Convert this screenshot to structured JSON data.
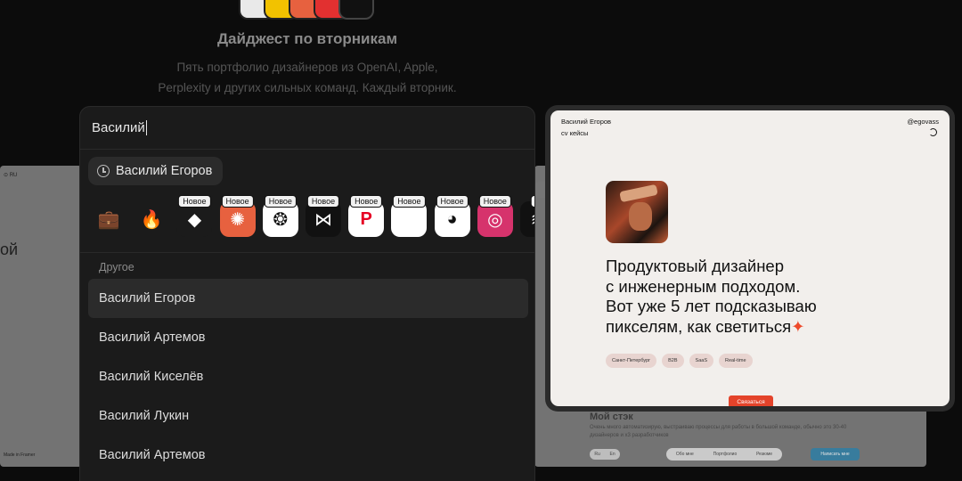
{
  "header": {
    "title": "Дайджест по вторникам",
    "subtitle_line1": "Пять портфолио дизайнеров из OpenAI, Apple,",
    "subtitle_line2": "Perplexity и других сильных команд. Каждый вторник."
  },
  "search": {
    "value": "Василий"
  },
  "recent": {
    "label": "Василий Егоров"
  },
  "app_strip": [
    {
      "name": "briefcase-icon",
      "glyph": "💼",
      "badge": "",
      "bg": "transparent"
    },
    {
      "name": "fire-icon",
      "glyph": "🔥",
      "badge": "",
      "bg": "transparent"
    },
    {
      "name": "cube-logo-icon",
      "glyph": "◆",
      "badge": "Новое",
      "bg": "#1b1b1b"
    },
    {
      "name": "claude-logo-icon",
      "glyph": "✺",
      "badge": "Новое",
      "bg": "#e7613f"
    },
    {
      "name": "openai-logo-icon",
      "glyph": "❂",
      "badge": "Новое",
      "bg": "#ffffff"
    },
    {
      "name": "perplexity-logo-icon",
      "glyph": "⋈",
      "badge": "Новое",
      "bg": "#111111"
    },
    {
      "name": "pinterest-logo-icon",
      "glyph": "P",
      "badge": "Новое",
      "bg": "#ffffff"
    },
    {
      "name": "apple-logo-icon",
      "glyph": "",
      "badge": "Новое",
      "bg": "#ffffff"
    },
    {
      "name": "figma-logo-icon",
      "glyph": "◕",
      "badge": "Новое",
      "bg": "#ffffff"
    },
    {
      "name": "instagram-logo-icon",
      "glyph": "◎",
      "badge": "Новое",
      "bg": "#d6336c"
    },
    {
      "name": "spotify-logo-icon",
      "glyph": "≋",
      "badge": "Н",
      "bg": "#111111"
    }
  ],
  "section_label": "Другое",
  "results": [
    "Василий Егоров",
    "Василий Артемов",
    "Василий Киселёв",
    "Василий Лукин",
    "Василий Артемов"
  ],
  "preview": {
    "name": "Василий Егоров",
    "nav": "cv кейсы",
    "handle": "@egovass",
    "headline_l1": "Продуктовый дизайнер",
    "headline_l2": "с инженерным подходом.",
    "headline_l3": "Вот уже 5 лет подсказываю",
    "headline_l4": "пикселям, как светиться",
    "tags": [
      "Санкт-Петербург",
      "B2B",
      "SaaS",
      "Real-time"
    ],
    "contact": "Связаться"
  },
  "background": {
    "left_lang": "⊙ RU",
    "left_word": "ой",
    "left_made": "Made in Framer",
    "stack_title": "Мой стэк",
    "stack_text": "Очень много автоматизирую, выстраиваю процессы для работы в большой команде, обычно это 30-40 дизайнеров и х3 разработчиков",
    "lang_ru": "Ru",
    "lang_en": "En",
    "tab1": "Обо мне",
    "tab2": "Портфолио",
    "tab3": "Резюме",
    "send": "Написать мне"
  }
}
